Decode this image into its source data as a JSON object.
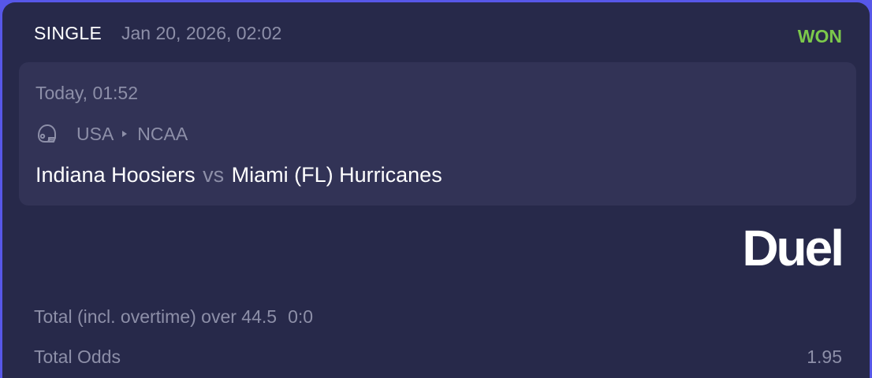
{
  "bet": {
    "type": "SINGLE",
    "placed_at": "Jan 20, 2026, 02:02",
    "status": "WON",
    "status_color": "#7cc94b"
  },
  "event": {
    "time": "Today, 01:52",
    "sport_icon": "football-helmet-icon",
    "country": "USA",
    "league": "NCAA",
    "home_team": "Indiana Hoosiers",
    "vs_label": "vs",
    "away_team": "Miami (FL) Hurricanes"
  },
  "brand": {
    "name": "Duel"
  },
  "selection": {
    "market": "Total (incl. overtime) over 44.5",
    "score": "0:0"
  },
  "odds": {
    "label": "Total Odds",
    "value": "1.95"
  },
  "colors": {
    "frame": "#5757e8",
    "card_background": "#27294a",
    "event_background": "#323356",
    "muted_text": "#8d8fa8",
    "primary_text": "#ffffff"
  }
}
